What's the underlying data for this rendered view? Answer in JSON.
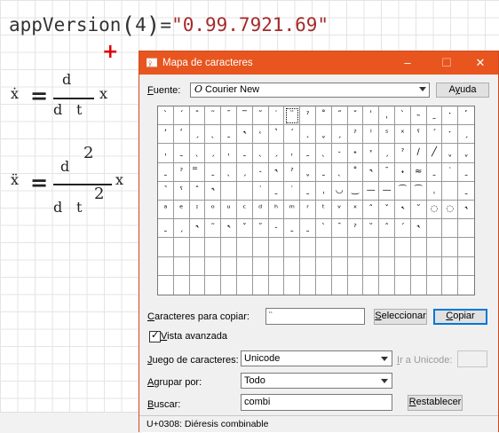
{
  "worksheet": {
    "app_version": {
      "func": "appVersion",
      "arg": "4",
      "equals": "=",
      "result": "\"0.99.7921.69\""
    },
    "eq1": {
      "lhs": "ẋ",
      "num": "d",
      "den_d": "d",
      "den_t": "t",
      "rhs": "x"
    },
    "eq2": {
      "lhs": "ẍ",
      "num": "d",
      "num_pow": "2",
      "den_d": "d",
      "den_t": "t",
      "den_pow": "2",
      "rhs": "x"
    }
  },
  "window": {
    "title": "Mapa de caracteres",
    "controls": {
      "minimize": "–",
      "maximize": "☐",
      "close": "✕"
    },
    "font_label_u": "F",
    "font_label_rest": "uente:",
    "font_value": "Courier New",
    "font_icon": "O",
    "help_label_u": "y",
    "help_label_pre": "A",
    "help_label_post": "uda",
    "grid_rows": [
      [
        "`",
        "´",
        "ˆ",
        "˜",
        "¯",
        "‾",
        "˘",
        "˙",
        "¨",
        "ˀ",
        "˚",
        "˝",
        "ˇ",
        "ˈ",
        "ˌ",
        "ˋ",
        "˵",
        "˷",
        "ˑ",
        "˹"
      ],
      [
        "ʼ",
        "ʹ",
        "ˏ",
        "ˎ",
        "ˍ",
        "˞",
        "˓",
        "ʽ",
        "ˊ",
        "˰",
        "ˬ",
        "ˏ",
        "ˀ",
        "ˡ",
        "ˢ",
        "ˣ",
        "ˤ",
        "ˊ",
        "ˑ",
        "ˏ"
      ],
      [
        "ˌ",
        "ˍ",
        "ˎ",
        "ˏ",
        "ˌ",
        "ˍ",
        "ˎ",
        "ˏ",
        "ˌ",
        "ˍ",
        "ˎ",
        "˗",
        "˖",
        "˕",
        "ˏ",
        "ˀ",
        "∕",
        "╱",
        "ˬ",
        "ˬ"
      ],
      [
        "ˍ",
        "ˀ",
        "̿",
        "ˍ",
        "ˎ",
        "ˏ",
        "˗",
        "˞",
        "ˀ",
        "ˬ",
        "ˍ",
        "ˎ",
        "˚",
        "˞",
        "ˉ",
        "˖",
        "≈",
        "ˍ",
        "˙",
        "ˍ"
      ],
      [
        "˺",
        "ˁ",
        "ˆ",
        "˞",
        "",
        "",
        "˙",
        "ˍ",
        "˙",
        "ˍ",
        "ˌ",
        "◡",
        "‿",
        "—",
        "—",
        "⁀",
        "⁀",
        "ˌ",
        "",
        "ˍ"
      ],
      [
        "ᵃ",
        "ᵉ",
        "ᶦ",
        "ᵒ",
        "ᵘ",
        "ᶜ",
        "ᵈ",
        "ʰ",
        "ᵐ",
        "ʳ",
        "ᵗ",
        "ᵛ",
        "ˣ",
        "ˆ",
        "ˇ",
        "˞",
        "˘",
        "◌",
        "◌",
        "˞"
      ],
      [
        "ˍ",
        "ˏ",
        "˞",
        "˜",
        "˞",
        "ˇ",
        "˘",
        "˗",
        "ˍ",
        "ˍ",
        "ˋ",
        "ˉ",
        "ˀ",
        "˘",
        "ˆ",
        "ˊ",
        "˞",
        "",
        "",
        ""
      ],
      [
        "",
        "",
        "",
        "",
        "",
        "",
        "",
        "",
        "",
        "",
        "",
        "",
        "",
        "",
        "",
        "",
        "",
        "",
        "",
        ""
      ],
      [
        "",
        "",
        "",
        "",
        "",
        "",
        "",
        "",
        "",
        "",
        "",
        "",
        "",
        "",
        "",
        "",
        "",
        "",
        "",
        ""
      ],
      [
        "",
        "",
        "",
        "",
        "",
        "",
        "",
        "",
        "",
        "",
        "",
        "",
        "",
        "",
        "",
        "",
        "",
        "",
        "",
        ""
      ]
    ],
    "copy_label_u": "C",
    "copy_label_rest": "aracteres para copiar:",
    "copy_value": "¨",
    "select_btn_u": "S",
    "select_btn_rest": "eleccionar",
    "copy_btn_u": "C",
    "copy_btn_rest": "opiar",
    "advanced_label_u": "V",
    "advanced_label_rest": "ista avanzada",
    "advanced_checked": "✓",
    "charset_label_u": "J",
    "charset_label_rest": "uego de caracteres:",
    "charset_value": "Unicode",
    "goto_unicode_u": "I",
    "goto_unicode_rest": "r a Unicode:",
    "group_label_u": "A",
    "group_label_rest": "grupar por:",
    "group_value": "Todo",
    "search_label_u": "B",
    "search_label_rest": "uscar:",
    "search_value": "combi",
    "reset_btn_u": "R",
    "reset_btn_rest": "establecer",
    "status": "U+0308: Diéresis combinable",
    "accent": "#e8551f"
  }
}
